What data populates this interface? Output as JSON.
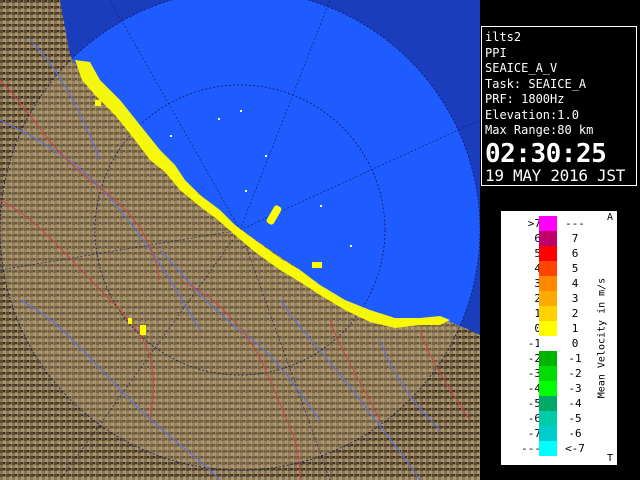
{
  "info": {
    "station": "ilts2",
    "mode": "PPI",
    "product": "SEAICE_A_V",
    "task": "Task: SEAICE_A",
    "prf": "PRF: 1800Hz",
    "elevation": "Elevation:1.0",
    "max_range": "Max Range:80 km",
    "time": "02:30:25",
    "date": "19 MAY 2016 JST"
  },
  "legend": {
    "title": "Mean Velocity in m/s",
    "corner_top": "A",
    "corner_bottom": "T",
    "rows": [
      {
        "left": ">7",
        "right": "---",
        "color": "#ff00ff"
      },
      {
        "left": "6",
        "right": "7",
        "color": "#c0006a"
      },
      {
        "left": "5",
        "right": "6",
        "color": "#ff0000"
      },
      {
        "left": "4",
        "right": "5",
        "color": "#ff4400"
      },
      {
        "left": "3",
        "right": "4",
        "color": "#ff8800"
      },
      {
        "left": "2",
        "right": "3",
        "color": "#ffaa00"
      },
      {
        "left": "1",
        "right": "2",
        "color": "#ffd200"
      },
      {
        "left": "0",
        "right": "1",
        "color": "#ffff00"
      },
      {
        "left": "-1",
        "right": "0",
        "color": "#ffffff"
      },
      {
        "left": "-2",
        "right": "-1",
        "color": "#00b400"
      },
      {
        "left": "-3",
        "right": "-2",
        "color": "#00dc00"
      },
      {
        "left": "-4",
        "right": "-3",
        "color": "#00ff00"
      },
      {
        "left": "-5",
        "right": "-4",
        "color": "#00aa66"
      },
      {
        "left": "-6",
        "right": "-5",
        "color": "#00ccaa"
      },
      {
        "left": "-7",
        "right": "-6",
        "color": "#00cccc"
      },
      {
        "left": "---",
        "right": "<-7",
        "color": "#00ffff"
      }
    ]
  },
  "colors": {
    "sea": "#1f5cff",
    "outer_sea": "#1a3dbd",
    "land": "#8a7654",
    "echo": "#ffff00"
  }
}
